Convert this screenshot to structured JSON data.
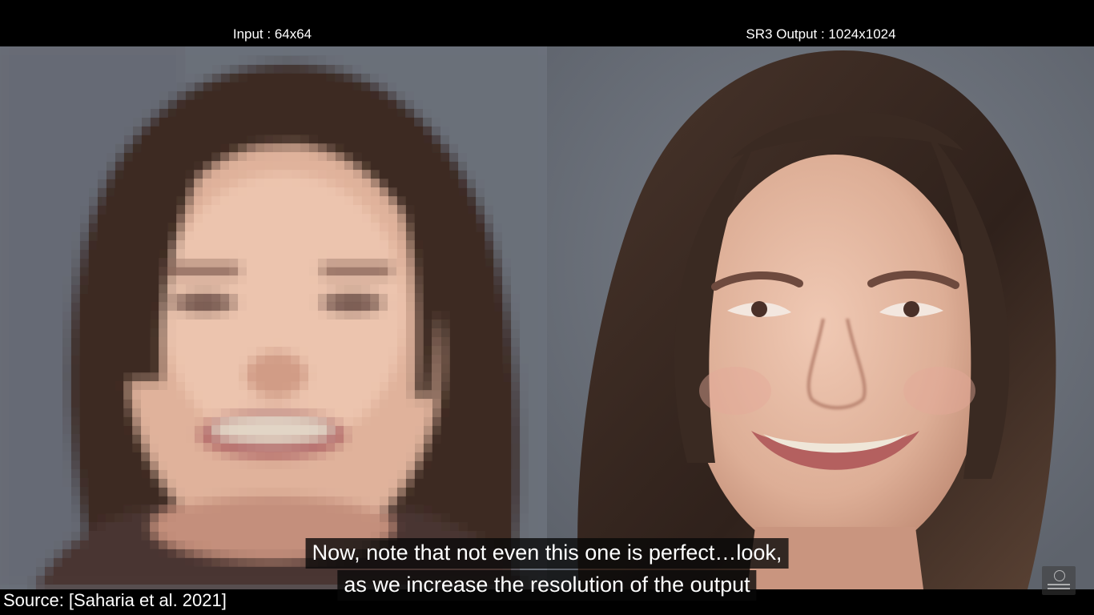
{
  "labels": {
    "input": "Input : 64x64",
    "output": "SR3 Output : 1024x1024"
  },
  "subtitles": {
    "line1": "Now, note that not even this one is perfect…look,",
    "line2": "as we increase the resolution of the output"
  },
  "source": "Source: [Saharia et al. 2021]",
  "images": {
    "left": "pixelated-face-photo",
    "right": "high-resolution-face-photo"
  },
  "watermark": "two-minute-papers-logo",
  "colors": {
    "background": "#000000",
    "backdrop": "#6e737d",
    "hair": "#3a2a22",
    "skin": "#e2b39c",
    "text": "#ffffff"
  }
}
